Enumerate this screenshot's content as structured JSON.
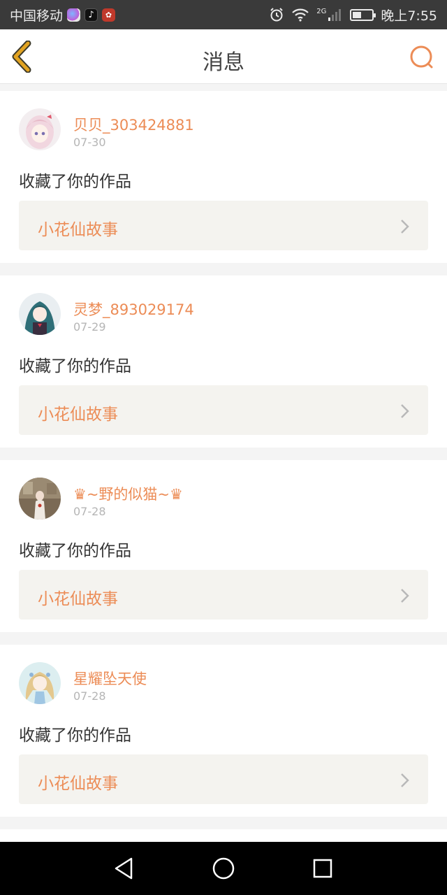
{
  "status_bar": {
    "carrier": "中国移动",
    "time": "晚上7:55",
    "network": "2G",
    "battery_level": 0.45,
    "app_icons": [
      "browser-app-icon",
      "tiktok-app-icon",
      "huawei-app-icon"
    ],
    "status_icons": [
      "alarm-icon",
      "wifi-icon",
      "signal-icon",
      "battery-icon"
    ]
  },
  "header": {
    "title": "消息",
    "back_icon": "back-chevron-icon",
    "search_icon": "search-icon"
  },
  "colors": {
    "accent": "#ec8c56",
    "back_icon": "#e2a321",
    "work_box_bg": "#f4f3ef",
    "page_bg": "#f4f4f4"
  },
  "messages": [
    {
      "username": "贝贝_303424881",
      "date": "07-30",
      "action": "收藏了你的作品",
      "work_title": "小花仙故事",
      "avatar": "avatar-pink-hair-girl"
    },
    {
      "username": "灵梦_893029174",
      "date": "07-29",
      "action": "收藏了你的作品",
      "work_title": "小花仙故事",
      "avatar": "avatar-teal-hair-girl"
    },
    {
      "username": "♛~野的似猫~♛",
      "date": "07-28",
      "action": "收藏了你的作品",
      "work_title": "小花仙故事",
      "avatar": "avatar-girl-scene"
    },
    {
      "username": "星耀坠天使",
      "date": "07-28",
      "action": "收藏了你的作品",
      "work_title": "小花仙故事",
      "avatar": "avatar-blonde-girl"
    }
  ],
  "nav_bar": {
    "buttons": [
      "back-triangle-icon",
      "home-circle-icon",
      "recents-square-icon"
    ]
  }
}
